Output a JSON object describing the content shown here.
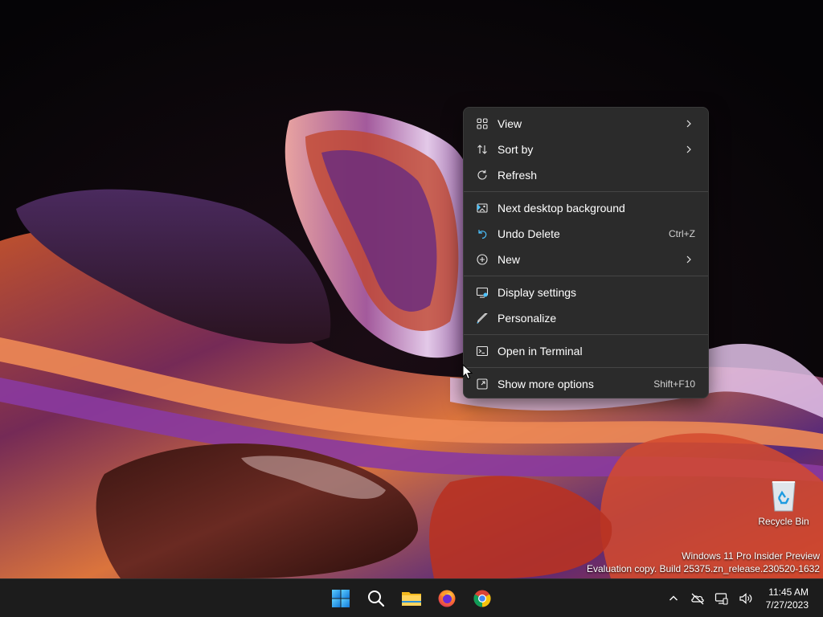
{
  "context_menu": {
    "items": [
      {
        "label": "View",
        "icon": "grid-view-icon",
        "has_submenu": true
      },
      {
        "label": "Sort by",
        "icon": "sort-icon",
        "has_submenu": true
      },
      {
        "label": "Refresh",
        "icon": "refresh-icon"
      },
      {
        "label": "Next desktop background",
        "icon": "next-background-icon"
      },
      {
        "label": "Undo Delete",
        "icon": "undo-icon",
        "shortcut": "Ctrl+Z"
      },
      {
        "label": "New",
        "icon": "new-plus-icon",
        "has_submenu": true
      },
      {
        "label": "Display settings",
        "icon": "display-settings-icon"
      },
      {
        "label": "Personalize",
        "icon": "brush-icon"
      },
      {
        "label": "Open in Terminal",
        "icon": "terminal-icon"
      },
      {
        "label": "Show more options",
        "icon": "more-options-icon",
        "shortcut": "Shift+F10"
      }
    ]
  },
  "desktop": {
    "recycle_bin_label": "Recycle Bin",
    "watermark": {
      "line1": "Windows 11 Pro Insider Preview",
      "line2": "Evaluation copy. Build 25375.zn_release.230520-1632"
    }
  },
  "taskbar": {
    "apps": [
      "start-icon",
      "search-icon",
      "file-explorer-icon",
      "firefox-icon",
      "chrome-icon"
    ],
    "tray": [
      "chevron-up-icon",
      "network-icon",
      "display-icon",
      "volume-icon"
    ],
    "clock": {
      "time": "11:45 AM",
      "date": "7/27/2023"
    }
  },
  "colors": {
    "menu_bg": "#2b2b2b",
    "taskbar_bg": "#1c1c1c",
    "accent_blue": "#0078d4"
  }
}
